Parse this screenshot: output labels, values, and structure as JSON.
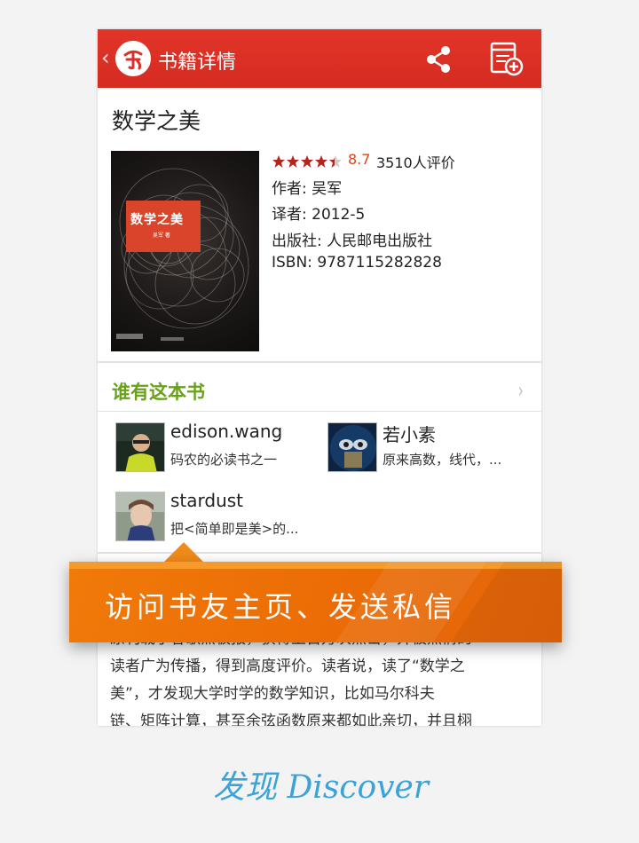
{
  "appbar": {
    "back_glyph": "‹",
    "title": "书籍详情",
    "icons": [
      "back-chevron-icon",
      "app-logo",
      "share-icon",
      "add-booklist-icon"
    ],
    "color": "#d9302a"
  },
  "book": {
    "title": "数学之美",
    "cover": {
      "title": "数学之美",
      "subtitle": "吴军 著"
    },
    "rating": {
      "stars": 4.5,
      "score": "8.7",
      "count": "3510人评价"
    },
    "author": "作者: 吴军",
    "translator": "译者: 2012-5",
    "publisher": "出版社: 人民邮电出版社",
    "isbn": "ISBN: 9787115282828"
  },
  "owners": {
    "title": "谁有这本书",
    "arrow": "›",
    "items": [
      {
        "name": "edison.wang",
        "note": "码农的必读书之一"
      },
      {
        "name": "若小素",
        "note": "原来高数，线代，..."
      },
      {
        "name": "stardust",
        "note": "把<简单即是美>的..."
      }
    ]
  },
  "description": {
    "lines": [
      "原刊载于谷歌黑板报，获得上百万次点击，并被热情的",
      "读者广为传播，得到高度评价。读者说，读了“数学之",
      "美”，才发现大学时学的数学知识，比如马尔科夫",
      "链、矩阵计算，甚至余弦函数原来都如此亲切，并且栩"
    ]
  },
  "banner": {
    "text": "访问书友主页、发送私信",
    "color": "#ee7406"
  },
  "footer": {
    "label": "发现 Discover",
    "color": "#3aa3d8"
  }
}
